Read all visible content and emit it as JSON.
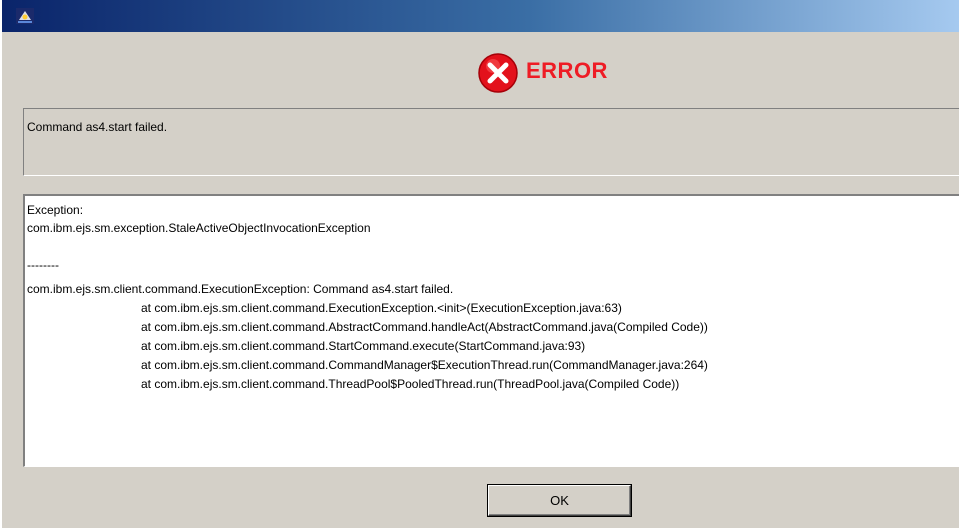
{
  "window": {
    "title": "",
    "title_icon": "java-app-icon"
  },
  "header": {
    "icon": "error-x-icon",
    "title": "ERROR",
    "title_color": "#ee1c25",
    "icon_color": "#e3111c"
  },
  "message": {
    "text": "Command as4.start failed."
  },
  "details": {
    "lines": [
      "Exception:",
      "com.ibm.ejs.sm.exception.StaleActiveObjectInvocationException",
      "",
      "--------",
      "com.ibm.ejs.sm.client.command.ExecutionException: Command as4.start failed.",
      "at com.ibm.ejs.sm.client.command.ExecutionException.<init>(ExecutionException.java:63)",
      "at com.ibm.ejs.sm.client.command.AbstractCommand.handleAct(AbstractCommand.java(Compiled Code))",
      "at com.ibm.ejs.sm.client.command.StartCommand.execute(StartCommand.java:93)",
      "at com.ibm.ejs.sm.client.command.CommandManager$ExecutionThread.run(CommandManager.java:264)",
      "at com.ibm.ejs.sm.client.command.ThreadPool$PooledThread.run(ThreadPool.java(Compiled Code))"
    ]
  },
  "buttons": {
    "ok_label": "OK"
  }
}
